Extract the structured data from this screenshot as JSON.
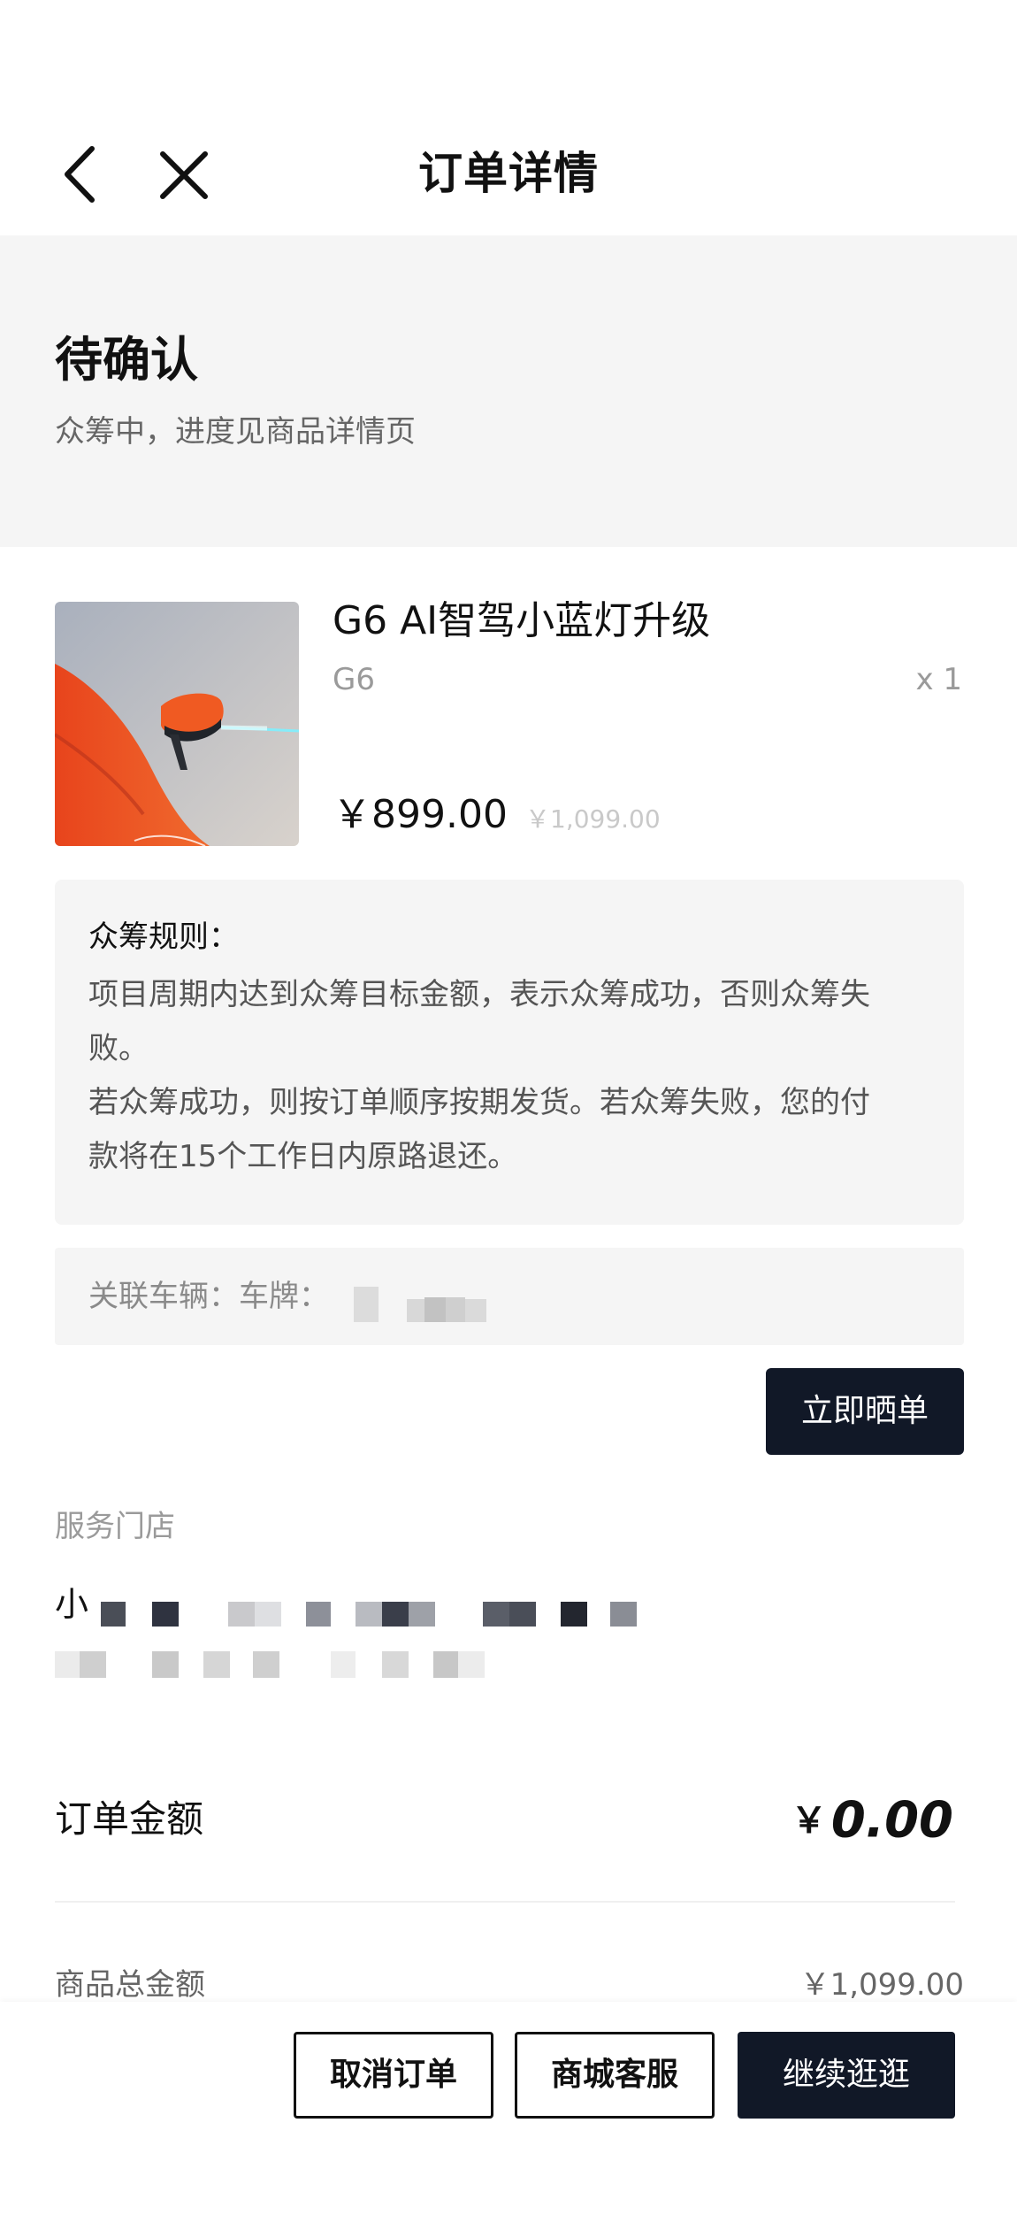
{
  "header": {
    "title": "订单详情",
    "back_icon": "back-chevron-icon",
    "close_icon": "close-icon"
  },
  "status": {
    "title": "待确认",
    "subtitle": "众筹中，进度见商品详情页"
  },
  "product": {
    "name": "G6 AI智驾小蓝灯升级",
    "spec": "G6",
    "quantity": "x 1",
    "price": "￥899.00",
    "original_price": "￥1,099.00",
    "image": "orange-car-side-mirror-image"
  },
  "rules": {
    "title": "众筹规则：",
    "lines": [
      "项目周期内达到众筹目标金额，表示众筹成功，否则众筹失",
      "败。",
      "若众筹成功，则按订单顺序按期发货。若众筹失败，您的付",
      "款将在15个工作日内原路退还。"
    ]
  },
  "vehicle": {
    "label": "关联车辆：车牌："
  },
  "share_button": "立即晒单",
  "store": {
    "label": "服务门店",
    "name_first_char": "小"
  },
  "amount": {
    "label": "订单金额",
    "currency": "￥",
    "value": "0.00"
  },
  "total": {
    "label": "商品总金额",
    "value": "￥1,099.00"
  },
  "bottom_bar": {
    "cancel": "取消订单",
    "service": "商城客服",
    "continue": "继续逛逛"
  },
  "colors": {
    "primary_dark": "#111827",
    "band_bg": "#f5f5f5",
    "muted_text": "#9a9a9a"
  }
}
